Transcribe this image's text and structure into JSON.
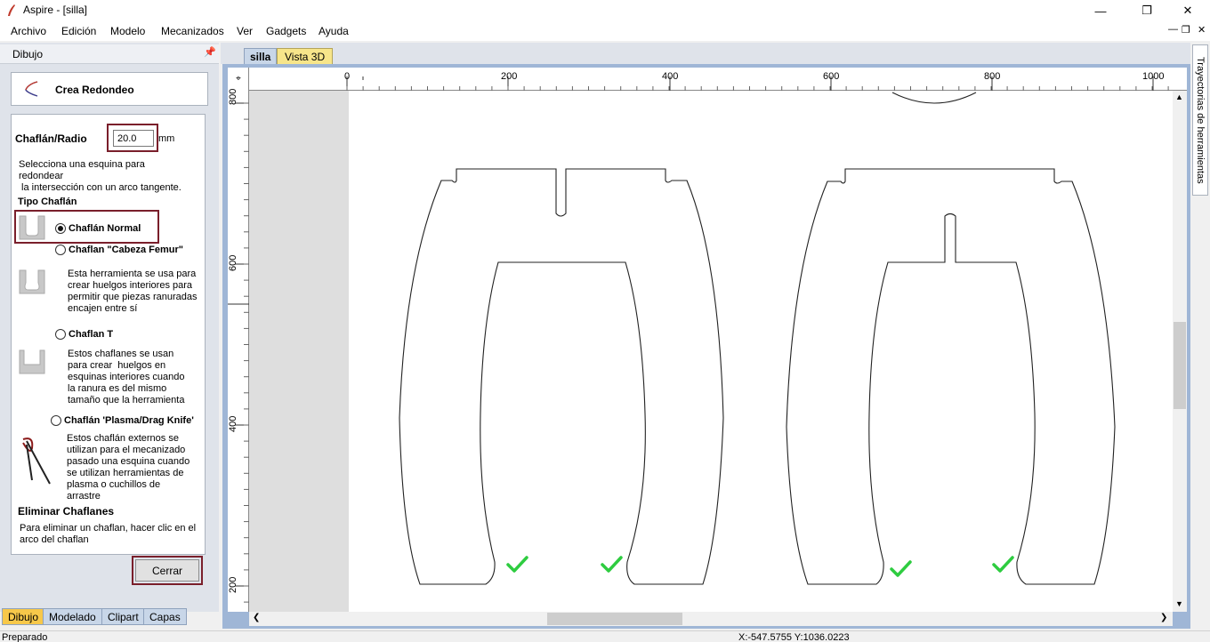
{
  "window": {
    "title": "Aspire - [silla]"
  },
  "menu": [
    "Archivo",
    "Edición",
    "Modelo",
    "Mecanizados",
    "Ver",
    "Gadgets",
    "Ayuda"
  ],
  "panel": {
    "title": "Dibujo",
    "tool_title": "Crea Redondeo",
    "radius_label": "Chaflán/Radio",
    "radius_value": "20.0",
    "radius_unit": "mm",
    "instructions": [
      "Selecciona una esquina para",
      "redondear",
      " la intersección con un arco tangente."
    ],
    "type_heading": "Tipo Chaflán",
    "options": [
      {
        "label": "Chaflán Normal",
        "selected": true,
        "desc": []
      },
      {
        "label": "Chaflan \"Cabeza Femur\"",
        "selected": false,
        "desc": [
          "Esta herramienta se usa para",
          "crear huelgos interiores para",
          "permitir que piezas ranuradas",
          "encajen entre sí"
        ]
      },
      {
        "label": "Chaflan T",
        "selected": false,
        "desc": [
          "Estos chaflanes se usan",
          "para crear  huelgos en",
          "esquinas interiores cuando",
          "la ranura es del mismo",
          "tamaño que la herramienta"
        ]
      },
      {
        "label": "Chaflán 'Plasma/Drag Knife'",
        "selected": false,
        "desc": [
          "Estos chaflán externos se",
          "utilizan para el mecanizado",
          "pasado una esquina cuando",
          "se utilizan herramientas de",
          "plasma o cuchillos de",
          "arrastre"
        ]
      }
    ],
    "remove_heading": "Eliminar Chaflanes",
    "remove_text": [
      "Para eliminar un chaflan, hacer clic en el",
      "arco del chaflan"
    ],
    "close_label": "Cerrar"
  },
  "bottom_tabs": [
    "Dibujo",
    "Modelado",
    "Clipart",
    "Capas"
  ],
  "doc_tabs": [
    "silla",
    "Vista 3D"
  ],
  "right_tab": "Trayectorias de herramientas",
  "ruler_top_labels": [
    "0",
    "200",
    "400",
    "600",
    "800",
    "1000"
  ],
  "ruler_left_labels": [
    "800",
    "600",
    "400",
    "200"
  ],
  "status": {
    "text": "Preparado",
    "coords": "X:-547.5755 Y:1036.0223"
  },
  "colors": {
    "check": "#2ecc40",
    "highlight": "#7a1f2b",
    "active_tab": "#f7c84a"
  }
}
